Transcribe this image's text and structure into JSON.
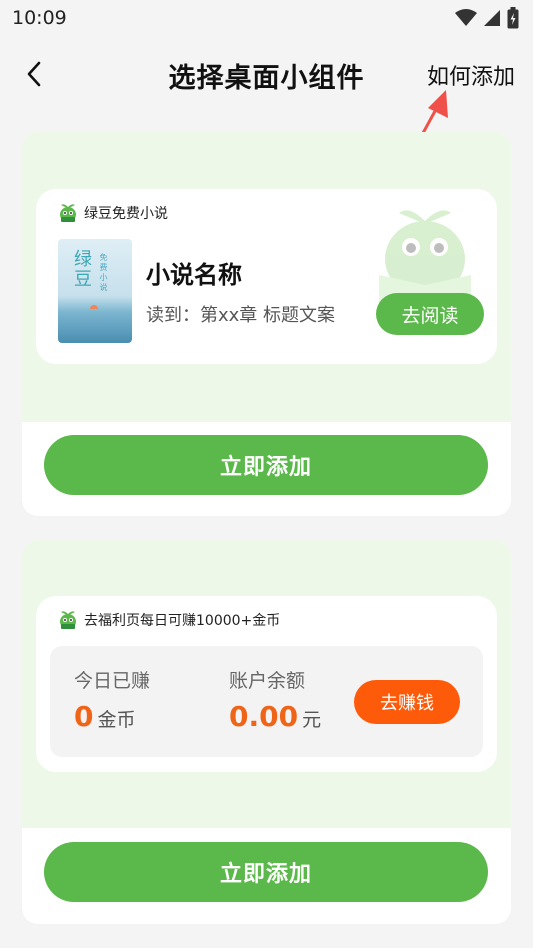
{
  "status_bar": {
    "time": "10:09"
  },
  "nav": {
    "title": "选择桌面小组件",
    "how_to_add": "如何添加"
  },
  "novel_widget": {
    "app_name": "绿豆免费小说",
    "cover_title": "绿豆",
    "cover_subtitle": "免费小说",
    "novel_name": "小说名称",
    "read_progress": "读到：第xx章 标题文案",
    "read_button": "去阅读",
    "add_button": "立即添加"
  },
  "coin_widget": {
    "header": "去福利页每日可赚10000+金币",
    "today_label": "今日已赚",
    "today_value": "0",
    "today_unit": "金币",
    "balance_label": "账户余额",
    "balance_value": "0.00",
    "balance_unit": "元",
    "earn_button": "去赚钱",
    "add_button": "立即添加"
  },
  "colors": {
    "primary_green": "#5bb84a",
    "preview_bg": "#eef8e8",
    "accent_orange": "#fd5a0a",
    "number_orange": "#f06418",
    "arrow_red": "#f0504a"
  }
}
